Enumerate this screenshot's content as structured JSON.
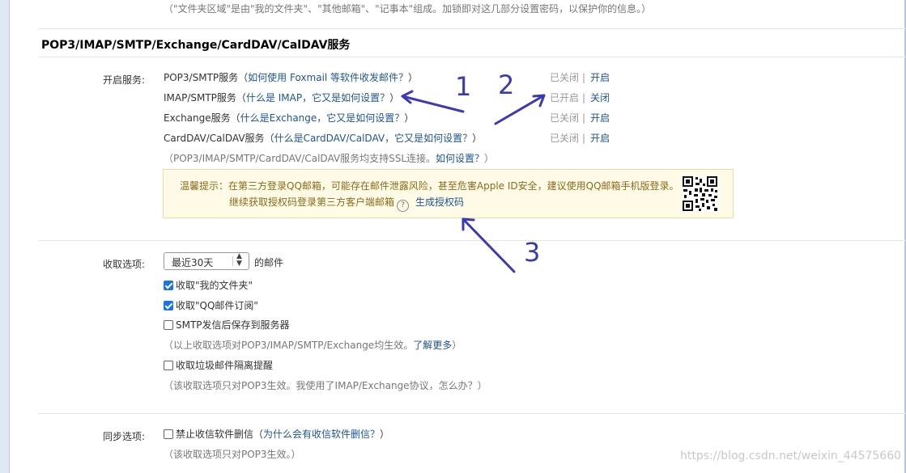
{
  "top_note": "（\"文件夹区域\"是由\"我的文件夹\"、\"其他邮箱\"、\"记事本\"组成。加锁即对这几部分设置密码，以保护你的信息。）",
  "section_title": "POP3/IMAP/SMTP/Exchange/CardDAV/CalDAV服务",
  "services": {
    "label": "开启服务:",
    "rows": [
      {
        "name": "POP3/SMTP服务",
        "hint_open": "（",
        "hint": "如何使用 Foxmail 等软件收发邮件？",
        "hint_close": "）",
        "state": "已关闭",
        "action": "开启"
      },
      {
        "name": "IMAP/SMTP服务",
        "hint_open": "（",
        "hint": "什么是 IMAP，它又是如何设置？",
        "hint_close": "）",
        "state": "已开启",
        "action": "关闭"
      },
      {
        "name": "Exchange服务",
        "hint_open": "（",
        "hint": "什么是Exchange，它又是如何设置？",
        "hint_close": "）",
        "state": "已关闭",
        "action": "开启"
      },
      {
        "name": "CardDAV/CalDAV服务",
        "hint_open": "（",
        "hint": "什么是CardDAV/CalDAV，它又是如何设置？",
        "hint_close": "）",
        "state": "已关闭",
        "action": "开启"
      }
    ],
    "ssl_note": "（POP3/IMAP/SMTP/CardDAV/CalDAV服务均支持SSL连接。",
    "ssl_link": "如何设置？",
    "ssl_close": "）",
    "separator": "|"
  },
  "tip": {
    "line1": "温馨提示：在第三方登录QQ邮箱，可能存在邮件泄露风险，甚至危害Apple ID安全，建议使用QQ邮箱手机版登录。",
    "line2": "继续获取授权码登录第三方客户端邮箱",
    "help_glyph": "?",
    "link": "生成授权码",
    "qr_icon": "qr-code-icon"
  },
  "receive": {
    "label": "收取选项:",
    "select_value": "最近30天",
    "select_suffix": "的邮件",
    "options": [
      {
        "label": "收取\"我的文件夹\"",
        "checked": true
      },
      {
        "label": "收取\"QQ邮件订阅\"",
        "checked": true
      },
      {
        "label": "SMTP发信后保存到服务器",
        "checked": false
      }
    ],
    "note1": "（以上收取选项对POP3/IMAP/SMTP/Exchange均生效。",
    "note1_link": "了解更多",
    "note1_close": "）",
    "spam_option": {
      "label": "收取垃圾邮件隔离提醒",
      "checked": false
    },
    "note2": "（该收取选项只对POP3生效。我使用了IMAP/Exchange协议，怎么办？）"
  },
  "sync": {
    "label": "同步选项:",
    "option": {
      "label": "禁止收信软件删信",
      "checked": false
    },
    "hint_open": "（",
    "hint": "为什么会有收信软件删信？",
    "hint_close": "）",
    "note": "（该收取选项只对POP3生效。）"
  },
  "annotations": {
    "n1": "1",
    "n2": "2",
    "n3": "3",
    "color": "#3a3ab4"
  },
  "watermark": "https://blog.csdn.net/weixin_44575660"
}
